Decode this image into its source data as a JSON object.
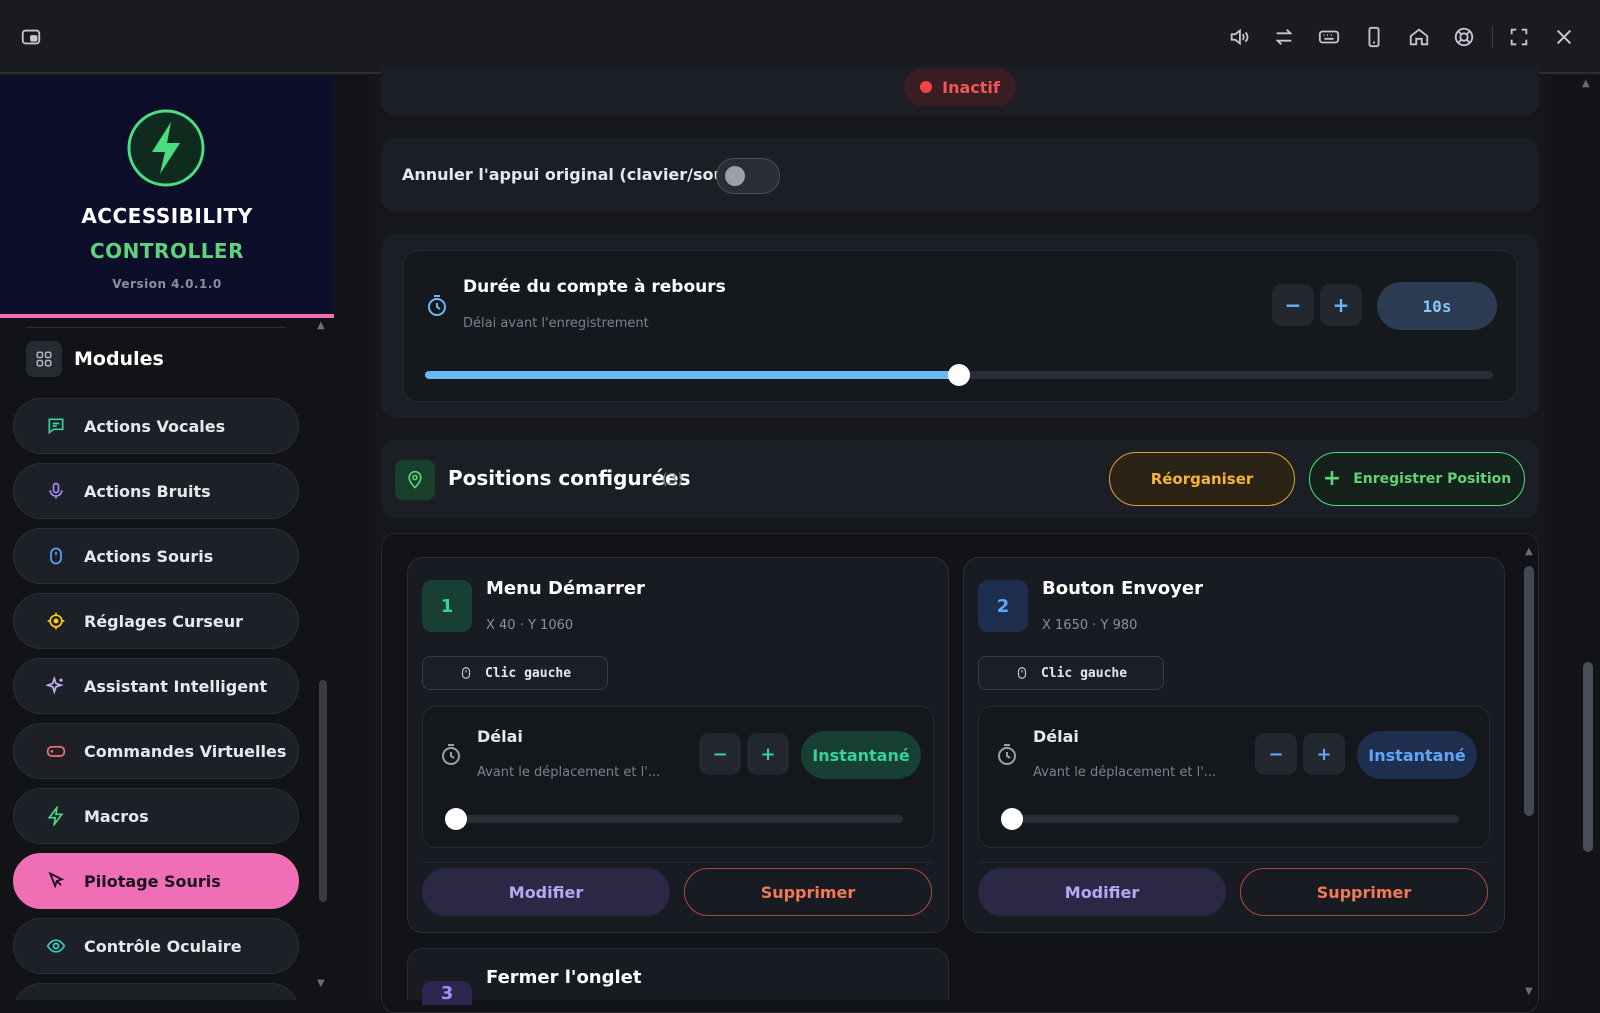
{
  "topbar": {
    "icons": [
      "picture-in-picture-icon",
      "volume-icon",
      "swap-icon",
      "keyboard-icon",
      "phone-icon",
      "home-icon",
      "help-circle-icon",
      "fullscreen-icon",
      "close-icon"
    ]
  },
  "sidebar": {
    "brand": {
      "line1": "ACCESSIBILITY",
      "line2": "CONTROLLER",
      "version": "Version 4.0.1.0"
    },
    "modules_title": "Modules",
    "items": [
      {
        "label": "Actions Vocales",
        "icon": "chat-icon",
        "color": "#34d399"
      },
      {
        "label": "Actions Bruits",
        "icon": "microphone-icon",
        "color": "#a78bfa"
      },
      {
        "label": "Actions Souris",
        "icon": "mouse-icon",
        "color": "#60a5fa"
      },
      {
        "label": "Réglages Curseur",
        "icon": "target-icon",
        "color": "#facc15"
      },
      {
        "label": "Assistant Intelligent",
        "icon": "sparkles-icon",
        "color": "#c4b5fd"
      },
      {
        "label": "Commandes Virtuelles",
        "icon": "gamepad-icon",
        "color": "#f87171"
      },
      {
        "label": "Macros",
        "icon": "bolt-icon",
        "color": "#4ade80"
      },
      {
        "label": "Pilotage Souris",
        "icon": "cursor-icon",
        "color": "#1b1020",
        "active": true
      },
      {
        "label": "Contrôle Oculaire",
        "icon": "eye-icon",
        "color": "#2dd4bf"
      }
    ]
  },
  "main": {
    "status": "Inactif",
    "cancel_original_label": "Annuler l'appui original (clavier/souris)",
    "cancel_original_on": false,
    "countdown": {
      "title": "Durée du compte à rebours",
      "subtitle": "Délai avant l'enregistrement",
      "value": "10s",
      "minus": "−",
      "plus": "+",
      "slider_fraction": 0.5
    },
    "positions": {
      "title": "Positions configurées",
      "count": "(3)",
      "reorganize": "Réorganiser",
      "record": "Enregistrer Position",
      "items": [
        {
          "num": "1",
          "title": "Menu Démarrer",
          "coords": "X 40 · Y 1060",
          "click": "Clic gauche",
          "delay_title": "Délai",
          "delay_sub": "Avant le déplacement et l'...",
          "delay_value": "Instantané",
          "delay_fraction": 0,
          "modify": "Modifier",
          "delete": "Supprimer",
          "badge_color": "#173f33",
          "num_color": "#34d399",
          "pill_bg": "#173f33",
          "pill_color": "#34d399"
        },
        {
          "num": "2",
          "title": "Bouton Envoyer",
          "coords": "X 1650 · Y 980",
          "click": "Clic gauche",
          "delay_title": "Délai",
          "delay_sub": "Avant le déplacement et l'...",
          "delay_value": "Instantané",
          "delay_fraction": 0,
          "modify": "Modifier",
          "delete": "Supprimer",
          "badge_color": "#1d2e4f",
          "num_color": "#60a5fa",
          "pill_bg": "#1d2e4f",
          "pill_color": "#60a5fa"
        },
        {
          "num": "3",
          "title": "Fermer l'onglet",
          "badge_color": "#2e2550",
          "num_color": "#a78bfa"
        }
      ]
    }
  },
  "colors": {
    "accent_pink": "#f06eb5",
    "accent_green": "#5fd37a",
    "accent_blue": "#69b9f2",
    "danger": "#ef4444"
  }
}
